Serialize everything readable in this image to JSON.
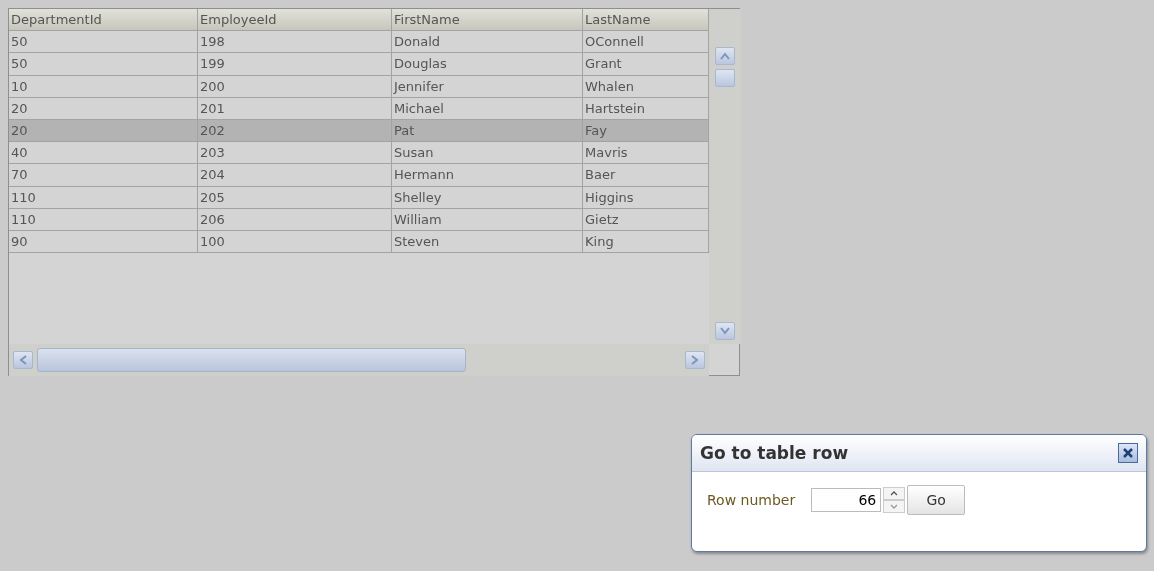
{
  "table": {
    "columns": [
      "DepartmentId",
      "EmployeeId",
      "FirstName",
      "LastName"
    ],
    "rows": [
      {
        "cells": [
          "50",
          "198",
          "Donald",
          "OConnell"
        ],
        "selected": false
      },
      {
        "cells": [
          "50",
          "199",
          "Douglas",
          "Grant"
        ],
        "selected": false
      },
      {
        "cells": [
          "10",
          "200",
          "Jennifer",
          "Whalen"
        ],
        "selected": false
      },
      {
        "cells": [
          "20",
          "201",
          "Michael",
          "Hartstein"
        ],
        "selected": false
      },
      {
        "cells": [
          "20",
          "202",
          "Pat",
          "Fay"
        ],
        "selected": true
      },
      {
        "cells": [
          "40",
          "203",
          "Susan",
          "Mavris"
        ],
        "selected": false
      },
      {
        "cells": [
          "70",
          "204",
          "Hermann",
          "Baer"
        ],
        "selected": false
      },
      {
        "cells": [
          "110",
          "205",
          "Shelley",
          "Higgins"
        ],
        "selected": false
      },
      {
        "cells": [
          "110",
          "206",
          "William",
          "Gietz"
        ],
        "selected": false
      },
      {
        "cells": [
          "90",
          "100",
          "Steven",
          "King"
        ],
        "selected": false
      }
    ]
  },
  "dialog": {
    "title": "Go to table row",
    "label": "Row number",
    "value": "66",
    "button": "Go"
  }
}
